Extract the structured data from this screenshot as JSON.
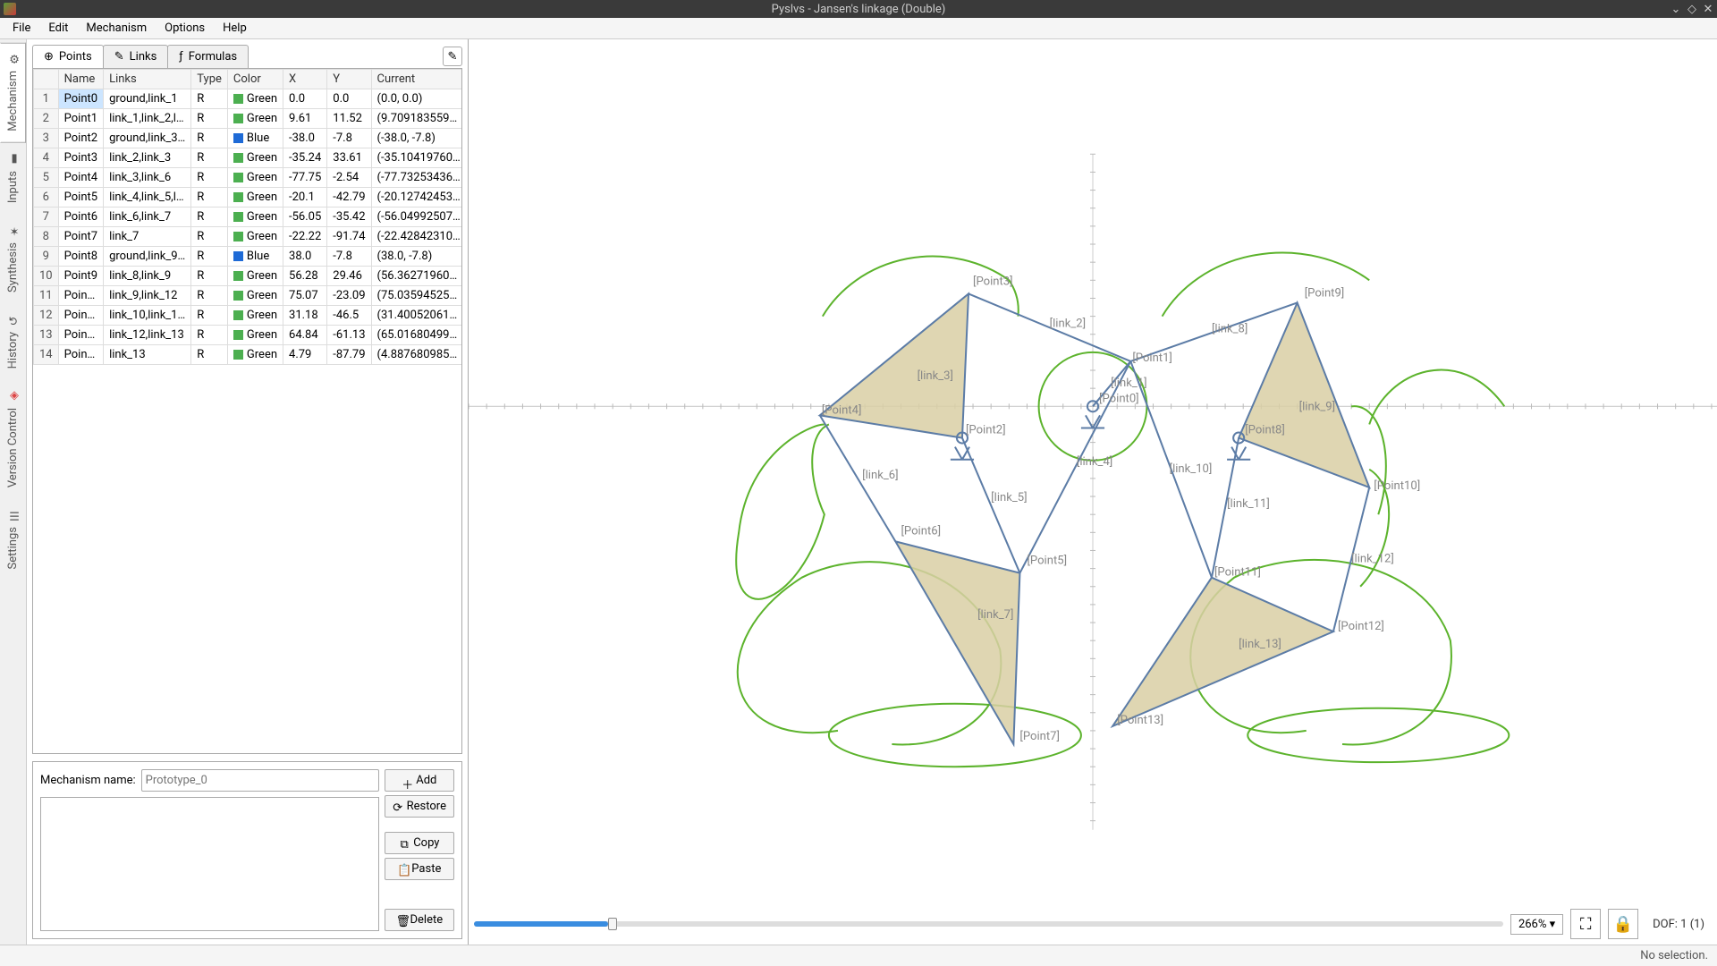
{
  "title": "Pyslvs - Jansen's linkage (Double)",
  "menu": [
    "File",
    "Edit",
    "Mechanism",
    "Options",
    "Help"
  ],
  "sidebar": [
    "Mechanism",
    "Inputs",
    "Synthesis",
    "History",
    "Version Control",
    "Settings"
  ],
  "tabs": {
    "points": "Points",
    "links": "Links",
    "formulas": "Formulas"
  },
  "cols": [
    "Name",
    "Links",
    "Type",
    "Color",
    "X",
    "Y",
    "Current"
  ],
  "rows": [
    {
      "n": "Point0",
      "l": "ground,link_1",
      "t": "R",
      "c": "Green",
      "ch": "#4caf50",
      "x": "0.0",
      "y": "0.0",
      "cur": "(0.0, 0.0)"
    },
    {
      "n": "Point1",
      "l": "link_1,link_2,l…",
      "t": "R",
      "c": "Green",
      "ch": "#4caf50",
      "x": "9.61",
      "y": "11.52",
      "cur": "(9.709183559…"
    },
    {
      "n": "Point2",
      "l": "ground,link_3…",
      "t": "R",
      "c": "Blue",
      "ch": "#1e6ad6",
      "x": "-38.0",
      "y": "-7.8",
      "cur": "(-38.0, -7.8)"
    },
    {
      "n": "Point3",
      "l": "link_2,link_3",
      "t": "R",
      "c": "Green",
      "ch": "#4caf50",
      "x": "-35.24",
      "y": "33.61",
      "cur": "(-35.10419760…"
    },
    {
      "n": "Point4",
      "l": "link_3,link_6",
      "t": "R",
      "c": "Green",
      "ch": "#4caf50",
      "x": "-77.75",
      "y": "-2.54",
      "cur": "(-77.73253436…"
    },
    {
      "n": "Point5",
      "l": "link_4,link_5,l…",
      "t": "R",
      "c": "Green",
      "ch": "#4caf50",
      "x": "-20.1",
      "y": "-42.79",
      "cur": "(-20.12742453…"
    },
    {
      "n": "Point6",
      "l": "link_6,link_7",
      "t": "R",
      "c": "Green",
      "ch": "#4caf50",
      "x": "-56.05",
      "y": "-35.42",
      "cur": "(-56.04992507…"
    },
    {
      "n": "Point7",
      "l": "link_7",
      "t": "R",
      "c": "Green",
      "ch": "#4caf50",
      "x": "-22.22",
      "y": "-91.74",
      "cur": "(-22.42842310…"
    },
    {
      "n": "Point8",
      "l": "ground,link_9…",
      "t": "R",
      "c": "Blue",
      "ch": "#1e6ad6",
      "x": "38.0",
      "y": "-7.8",
      "cur": "(38.0, -7.8)"
    },
    {
      "n": "Point9",
      "l": "link_8,link_9",
      "t": "R",
      "c": "Green",
      "ch": "#4caf50",
      "x": "56.28",
      "y": "29.46",
      "cur": "(56.36271960…"
    },
    {
      "n": "Poin…",
      "l": "link_9,link_12",
      "t": "R",
      "c": "Green",
      "ch": "#4caf50",
      "x": "75.07",
      "y": "-23.09",
      "cur": "(75.03594525…"
    },
    {
      "n": "Poin…",
      "l": "link_10,link_1…",
      "t": "R",
      "c": "Green",
      "ch": "#4caf50",
      "x": "31.18",
      "y": "-46.5",
      "cur": "(31.40052061…"
    },
    {
      "n": "Poin…",
      "l": "link_12,link_13",
      "t": "R",
      "c": "Green",
      "ch": "#4caf50",
      "x": "64.84",
      "y": "-61.13",
      "cur": "(65.01680499…"
    },
    {
      "n": "Poin…",
      "l": "link_13",
      "t": "R",
      "c": "Green",
      "ch": "#4caf50",
      "x": "4.79",
      "y": "-87.79",
      "cur": "(4.887680985…"
    }
  ],
  "mech_name_label": "Mechanism name:",
  "mech_name_placeholder": "Prototype_0",
  "btns": {
    "add": "Add",
    "restore": "Restore",
    "copy": "Copy",
    "paste": "Paste",
    "delete": "Delete"
  },
  "zoom": "266%",
  "dof": "DOF:  1 (1)",
  "status": "No selection.",
  "canvas_labels": {
    "points": [
      "[Point0]",
      "[Point1]",
      "[Point2]",
      "[Point3]",
      "[Point4]",
      "[Point5]",
      "[Point6]",
      "[Point7]",
      "[Point8]",
      "[Point9]",
      "[Point10]",
      "[Point11]",
      "[Point12]",
      "[Point13]"
    ],
    "links": [
      "[link_1]",
      "[link_2]",
      "[link_3]",
      "[link_4]",
      "[link_5]",
      "[link_6]",
      "[link_7]",
      "[link_8]",
      "[link_9]",
      "[link_10]",
      "[link_11]",
      "[link_12]",
      "[link_13]"
    ]
  }
}
